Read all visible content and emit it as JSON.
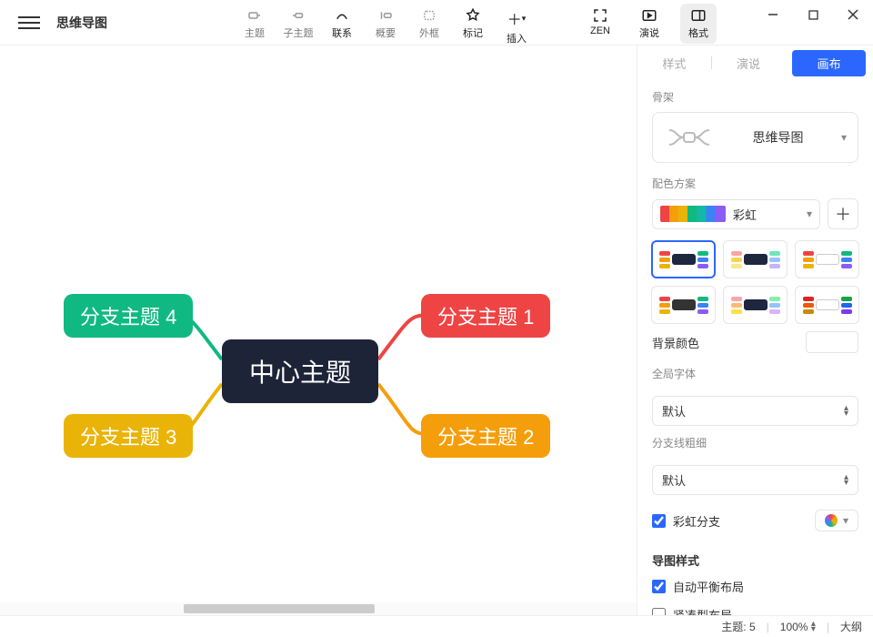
{
  "app": {
    "title": "思维导图"
  },
  "toolbar": {
    "topic": "主题",
    "subtopic": "子主题",
    "relationship": "联系",
    "summary": "概要",
    "boundary": "外框",
    "marker": "标记",
    "insert": "插入",
    "zen": "ZEN",
    "pitch": "演说",
    "format": "格式"
  },
  "panel": {
    "tabs": {
      "style": "样式",
      "pitch": "演说",
      "canvas": "画布"
    },
    "skeleton": {
      "label": "骨架",
      "value": "思维导图"
    },
    "color_scheme": {
      "label": "配色方案",
      "value": "彩虹"
    },
    "bgcolor": {
      "label": "背景颜色"
    },
    "global_font": {
      "label": "全局字体",
      "value": "默认"
    },
    "branch_width": {
      "label": "分支线粗细",
      "value": "默认"
    },
    "rainbow_branch": {
      "label": "彩虹分支",
      "checked": true
    },
    "map_style": {
      "label": "导图样式",
      "auto_balance": {
        "label": "自动平衡布局",
        "checked": true
      },
      "compact": {
        "label": "紧凑型布局",
        "checked": false
      }
    }
  },
  "statusbar": {
    "topic_count_label": "主题:",
    "topic_count": "5",
    "zoom": "100%",
    "outline": "大纲"
  },
  "mindmap": {
    "central": "中心主题",
    "branch1": "分支主题 1",
    "branch2": "分支主题 2",
    "branch3": "分支主题 3",
    "branch4": "分支主题 4"
  }
}
